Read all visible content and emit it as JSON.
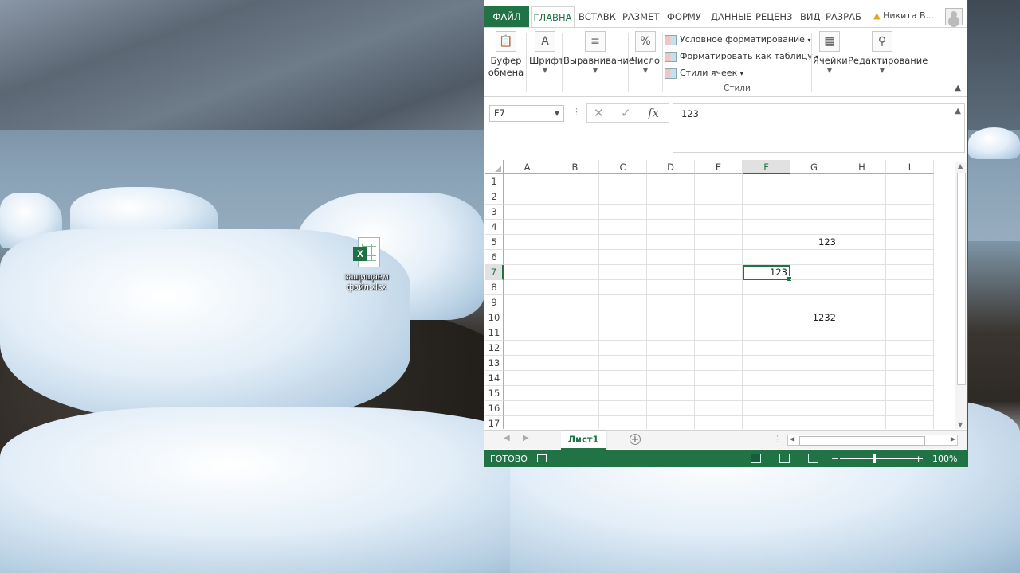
{
  "desktop": {
    "icon_label": "защищаем файл.xlsx"
  },
  "excel": {
    "ribbon_tabs": [
      "ФАЙЛ",
      "ГЛАВНА",
      "ВСТАВК",
      "РАЗМЕТ",
      "ФОРМУ",
      "ДАННЫЕ",
      "РЕЦЕНЗ",
      "ВИД",
      "РАЗРАБ"
    ],
    "user_name": "Никита В...",
    "ribbon": {
      "clipboard_label": "Буфер обмена",
      "font_label": "Шрифт",
      "alignment_label": "Выравнивание",
      "number_label": "Число",
      "conditional_formatting": "Условное форматирование",
      "format_as_table": "Форматировать как таблицу",
      "cell_styles": "Стили ячеек",
      "styles_group_label": "Стили",
      "cells_label": "Ячейки",
      "editing_label": "Редактирование"
    },
    "name_box": "F7",
    "formula_bar": "123",
    "columns": [
      "A",
      "B",
      "C",
      "D",
      "E",
      "F",
      "G",
      "H",
      "I"
    ],
    "rows": [
      "1",
      "2",
      "3",
      "4",
      "5",
      "6",
      "7",
      "8",
      "9",
      "10",
      "11",
      "12",
      "13",
      "14",
      "15",
      "16",
      "17"
    ],
    "cells": {
      "G5": "123",
      "F7": "123",
      "G10": "1232"
    },
    "active_cell": "F7",
    "sheet_tab": "Лист1",
    "status": {
      "ready": "ГОТОВО",
      "zoom": "100%"
    },
    "colors": {
      "accent": "#217346"
    }
  }
}
